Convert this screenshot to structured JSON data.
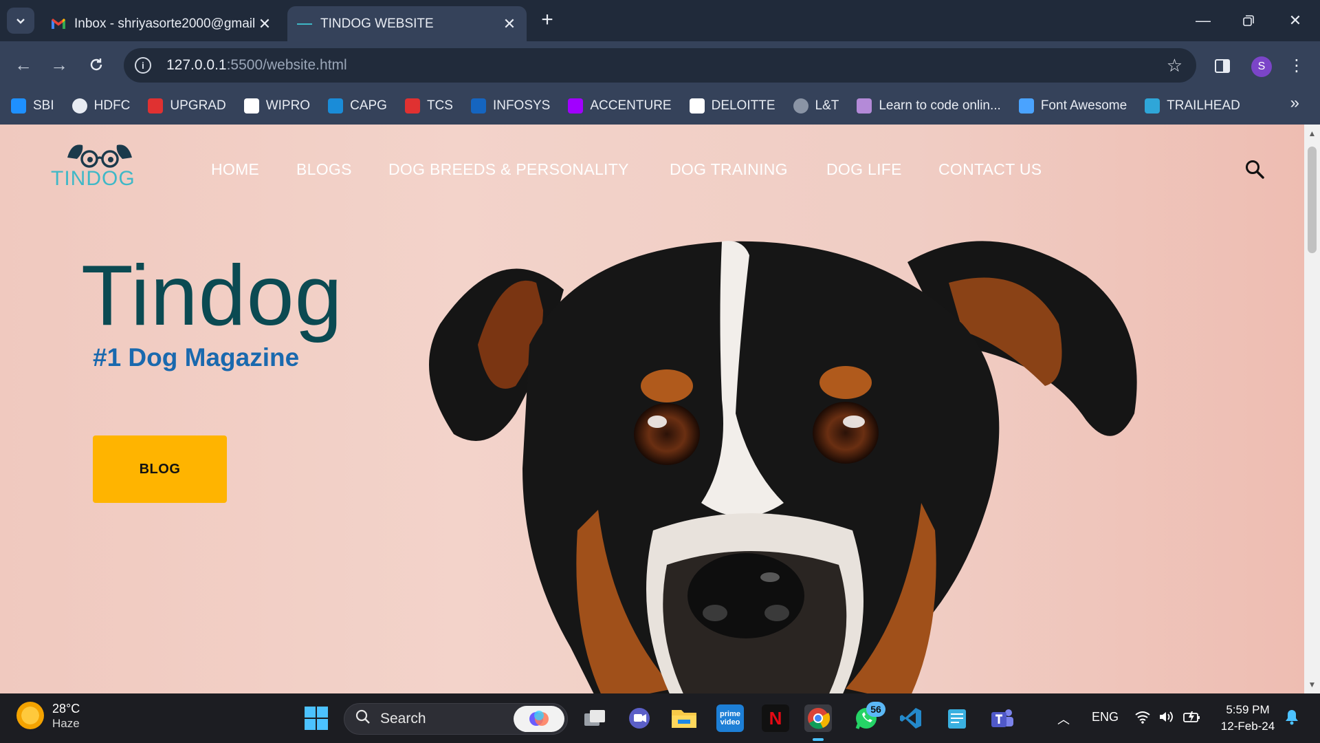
{
  "browser": {
    "tabs": [
      {
        "title": "Inbox - shriyasorte2000@gmail",
        "active": false,
        "icon": "gmail-icon"
      },
      {
        "title": "TINDOG WEBSITE",
        "active": true,
        "icon": "tindog-favicon"
      }
    ],
    "url_host": "127.0.0.1",
    "url_path": ":5500/website.html",
    "profile_initial": "S",
    "bookmarks": [
      {
        "label": "SBI",
        "icon": "sbi-icon",
        "color": "#1e90ff"
      },
      {
        "label": "HDFC",
        "icon": "globe-icon",
        "color": "#e8ecf3"
      },
      {
        "label": "UPGRAD",
        "icon": "upgrad-icon",
        "color": "#e03131"
      },
      {
        "label": "WIPRO",
        "icon": "wipro-icon",
        "color": "#ffffff"
      },
      {
        "label": "CAPG",
        "icon": "capg-icon",
        "color": "#1a8cd8"
      },
      {
        "label": "TCS",
        "icon": "tcs-icon",
        "color": "#e03131"
      },
      {
        "label": "INFOSYS",
        "icon": "infosys-icon",
        "color": "#1565c0"
      },
      {
        "label": "ACCENTURE",
        "icon": "accenture-icon",
        "color": "#a100ff"
      },
      {
        "label": "DELOITTE",
        "icon": "deloitte-icon",
        "color": "#ffffff"
      },
      {
        "label": "L&T",
        "icon": "globe-icon",
        "color": "#8a94a5"
      },
      {
        "label": "Learn to code onlin...",
        "icon": "codecademy-icon",
        "color": "#b48ad8"
      },
      {
        "label": "Font Awesome",
        "icon": "flag-icon",
        "color": "#4aa3ff"
      },
      {
        "label": "TRAILHEAD",
        "icon": "trailhead-icon",
        "color": "#2fa6d8"
      }
    ]
  },
  "site": {
    "logo_text": "TINDOG",
    "nav": [
      "HOME",
      "BLOGS",
      "DOG BREEDS & PERSONALITY",
      "DOG TRAINING",
      "DOG LIFE",
      "CONTACT US"
    ],
    "hero_title": "Tindog",
    "hero_subtitle": "#1 Dog Magazine",
    "cta_label": "BLOG"
  },
  "taskbar": {
    "temperature": "28°C",
    "condition": "Haze",
    "search_placeholder": "Search",
    "whatsapp_badge": "56",
    "language": "ENG",
    "time": "5:59 PM",
    "date": "12-Feb-24"
  },
  "colors": {
    "accent_cta": "#ffb400",
    "hero_title": "#0b4a52",
    "hero_subtitle": "#1a69ae",
    "logo": "#3fb8c7"
  }
}
